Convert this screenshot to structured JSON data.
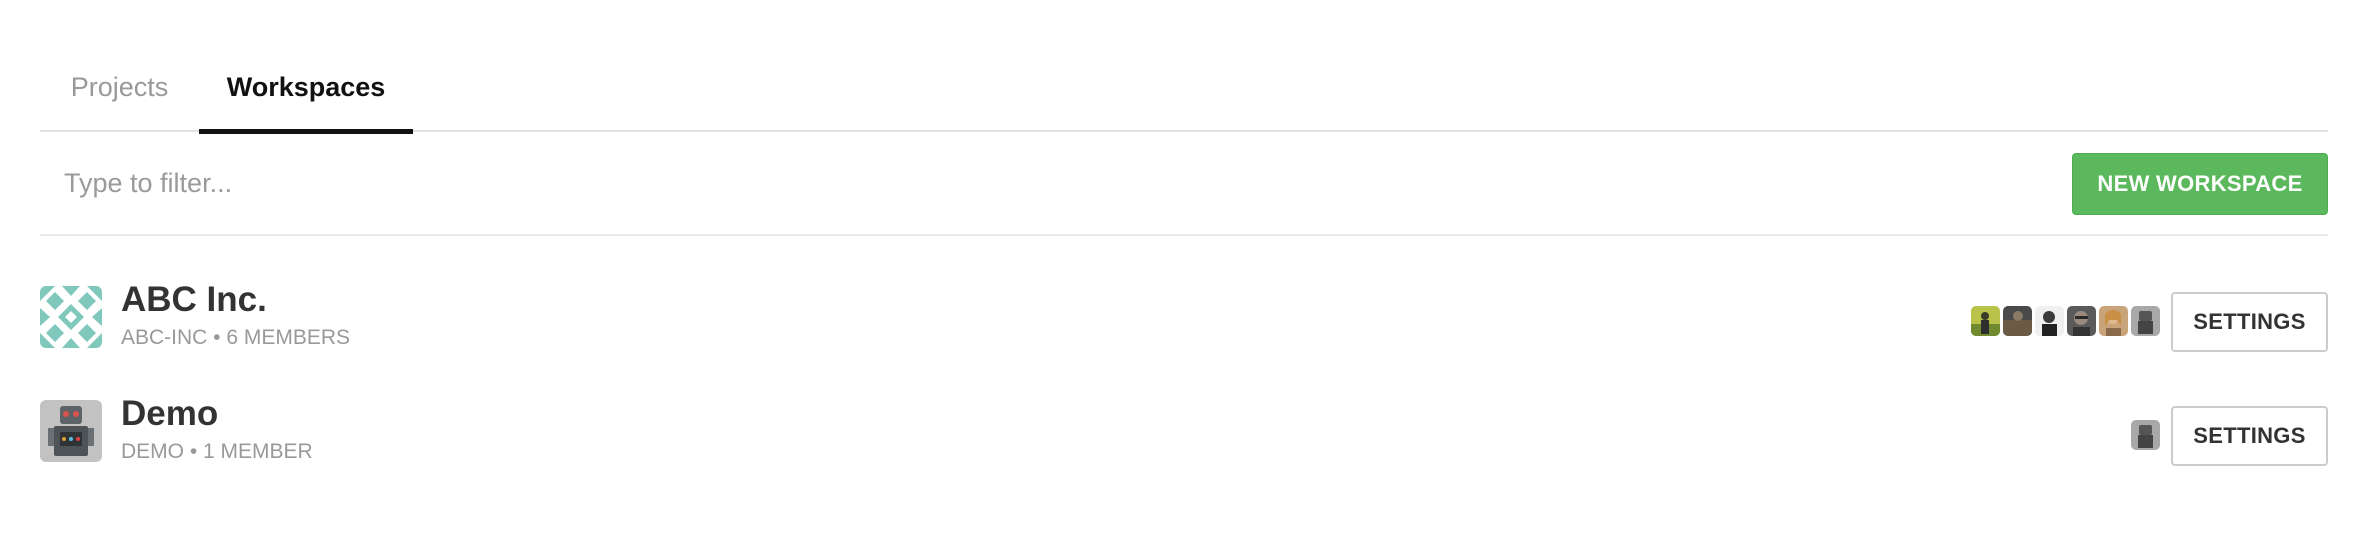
{
  "tabs": [
    {
      "label": "Projects",
      "active": false
    },
    {
      "label": "Workspaces",
      "active": true
    }
  ],
  "filter": {
    "placeholder": "Type to filter...",
    "value": ""
  },
  "new_workspace_label": "NEW WORKSPACE",
  "workspaces": [
    {
      "name": "ABC Inc.",
      "meta": "ABC-INC • 6 MEMBERS",
      "avatar": "teal-pattern-icon",
      "member_avatars": [
        "member-avatar",
        "member-avatar",
        "member-avatar",
        "member-avatar",
        "member-avatar",
        "member-avatar"
      ],
      "settings_label": "SETTINGS"
    },
    {
      "name": "Demo",
      "meta": "DEMO • 1 MEMBER",
      "avatar": "robot-icon",
      "member_avatars": [
        "member-avatar"
      ],
      "settings_label": "SETTINGS"
    }
  ],
  "colors": {
    "accent_green": "#5cb85c",
    "active_tab": "#111111",
    "muted_text": "#999999",
    "pattern_teal": "#7fc8bb"
  }
}
